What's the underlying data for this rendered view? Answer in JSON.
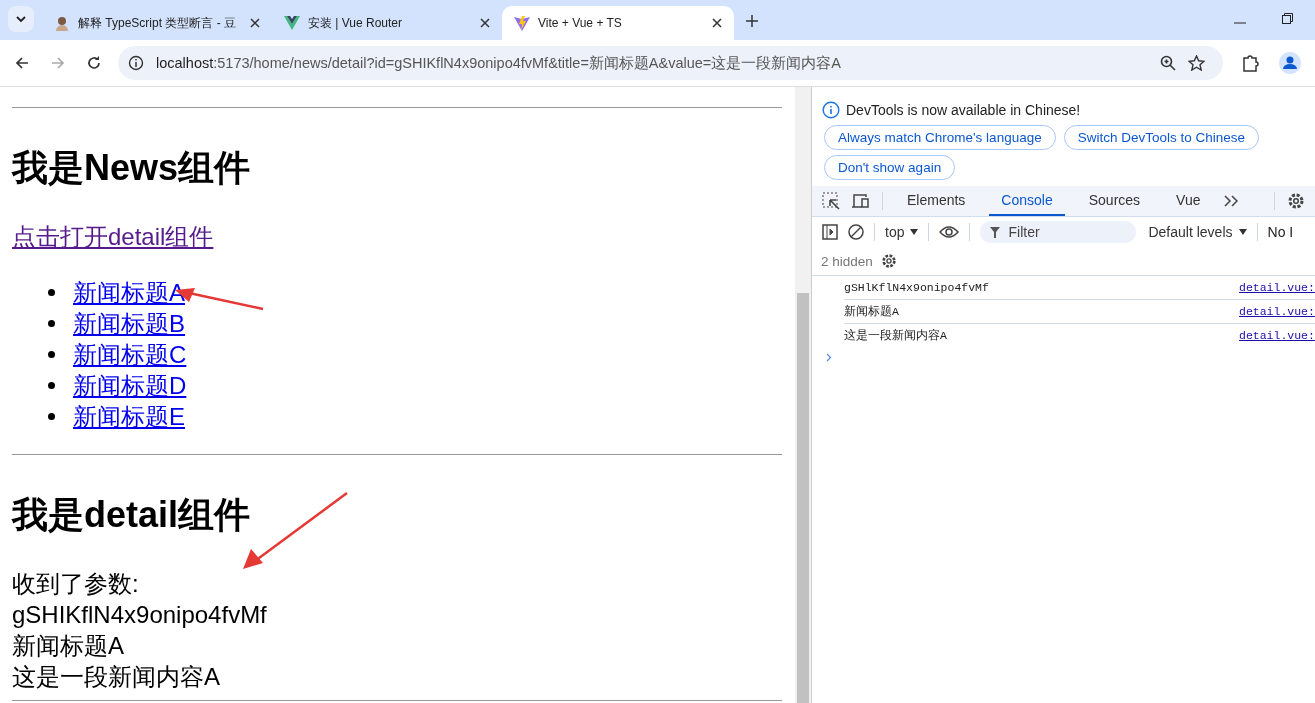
{
  "tabs": [
    {
      "title": "解释 TypeScript 类型断言 - 豆",
      "kind": "avatar",
      "selected": false
    },
    {
      "title": "安装 | Vue Router",
      "kind": "vue",
      "selected": false
    },
    {
      "title": "Vite + Vue + TS",
      "kind": "vite",
      "selected": true
    }
  ],
  "address": {
    "host": "localhost",
    "rest": ":5173/home/news/detail?id=gSHIKflN4x9onipo4fvMf&title=新闻标题A&value=这是一段新闻内容A"
  },
  "page": {
    "news_heading": "我是News组件",
    "detail_link": "点击打开detail组件",
    "news_items": [
      "新闻标题A",
      "新闻标题B",
      "新闻标题C",
      "新闻标题D",
      "新闻标题E"
    ],
    "detail_heading": "我是detail组件",
    "received_label": "收到了参数:",
    "params": [
      "gSHIKflN4x9onipo4fvMf",
      "新闻标题A",
      "这是一段新闻内容A"
    ]
  },
  "devtools": {
    "notice": "DevTools is now available in Chinese!",
    "notice_buttons": [
      "Always match Chrome's language",
      "Switch DevTools to Chinese",
      "Don't show again"
    ],
    "panels": [
      {
        "label": "Elements",
        "selected": false
      },
      {
        "label": "Console",
        "selected": true
      },
      {
        "label": "Sources",
        "selected": false
      },
      {
        "label": "Vue",
        "selected": false
      }
    ],
    "context": "top",
    "filter_placeholder": "Filter",
    "levels": "Default levels",
    "issues": "No I",
    "hidden": "2 hidden",
    "logs": [
      {
        "text": "gSHlKflN4x9onipo4fvMf",
        "source": "detail.vue:"
      },
      {
        "text": "新闻标题A",
        "source": "detail.vue:"
      },
      {
        "text": "这是一段新闻内容A",
        "source": "detail.vue:"
      }
    ]
  }
}
